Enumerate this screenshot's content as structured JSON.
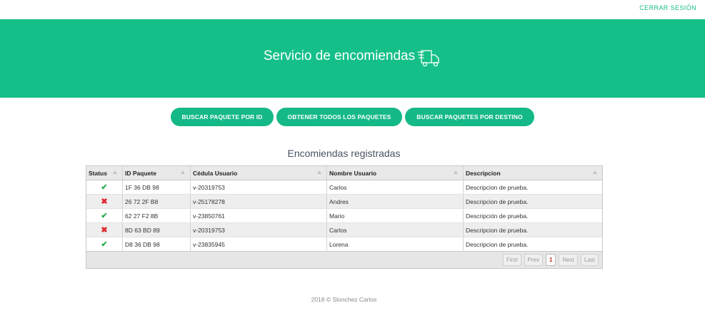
{
  "header": {
    "logout_label": "CERRAR SESIÓN"
  },
  "hero": {
    "title": "Servicio de encomiendas"
  },
  "actions": {
    "buscar_id": "BUSCAR PAQUETE POR ID",
    "obtener_todos": "OBTENER TODOS LOS PAQUETES",
    "buscar_destino": "BUSCAR PAQUETES POR DESTINO"
  },
  "table": {
    "title": "Encomiendas registradas",
    "columns": [
      "Status",
      "ID Paquete",
      "Cédula Usuario",
      "Nombre Usuario",
      "Descripcion"
    ],
    "rows": [
      {
        "status": "ok",
        "id": "1F 36 DB 98",
        "cedula": "v-20319753",
        "nombre": "Carlos",
        "descripcion": "Descripcion de prueba."
      },
      {
        "status": "fail",
        "id": "26 72 2F B8",
        "cedula": "v-25178278",
        "nombre": "Andres",
        "descripcion": "Descripcion de prueba."
      },
      {
        "status": "ok",
        "id": "62 27 F2 8B",
        "cedula": "v-23850761",
        "nombre": "Mario",
        "descripcion": "Descripción de prueba."
      },
      {
        "status": "fail",
        "id": "8D 63 BD 89",
        "cedula": "v-20319753",
        "nombre": "Carlos",
        "descripcion": "Descripcion de prueba."
      },
      {
        "status": "ok",
        "id": "D8 36 DB 98",
        "cedula": "v-23835945",
        "nombre": "Lorena",
        "descripcion": "Descripcion de prueba."
      }
    ],
    "status_icons": {
      "ok": "check-icon",
      "fail": "cross-icon"
    }
  },
  "pager": {
    "first": "First",
    "prev": "Prev",
    "current": "1",
    "next": "Next",
    "last": "Last"
  },
  "footer": {
    "text": "2018 © Slonchez Carlos"
  },
  "colors": {
    "brand": "#15c088",
    "ok": "#27ae4f",
    "fail": "#e0262d"
  }
}
